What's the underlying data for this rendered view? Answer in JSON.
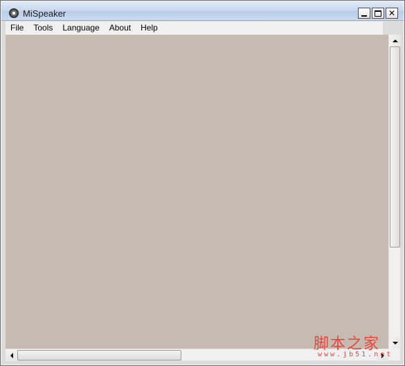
{
  "window": {
    "title": "MiSpeaker",
    "icon": "app-icon",
    "controls": {
      "minimize": "minimize-icon",
      "maximize": "maximize-icon",
      "close_glyph": "✕"
    }
  },
  "menu": {
    "items": [
      "File",
      "Tools",
      "Language",
      "About",
      "Help"
    ]
  },
  "client": {
    "background": "#c6bbb0"
  },
  "scrollbars": {
    "vertical": {
      "position_fraction": 0.0
    },
    "horizontal": {
      "position_fraction": 0.0
    }
  },
  "watermark": {
    "text": "脚本之家",
    "url": "www.jb51.net",
    "color": "#e8453c"
  }
}
